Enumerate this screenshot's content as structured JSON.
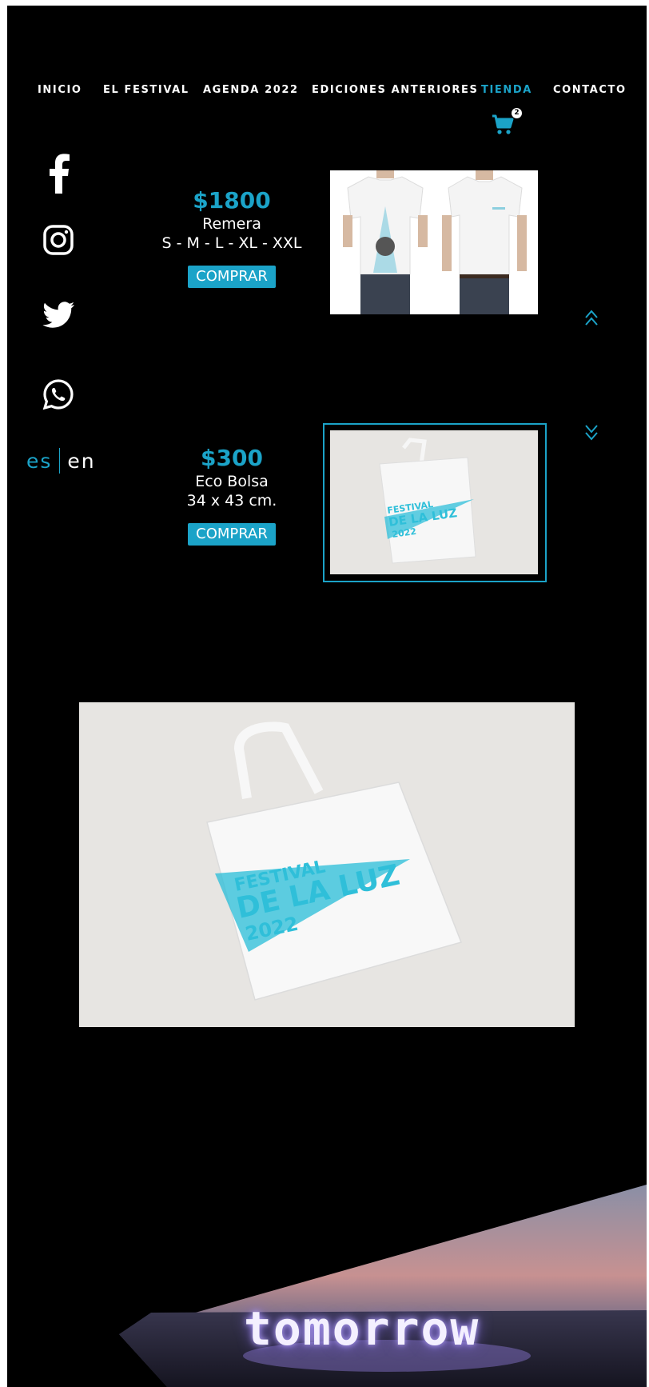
{
  "nav": {
    "items": [
      {
        "label": "INICIO",
        "active": false
      },
      {
        "label": "EL FESTIVAL",
        "active": false
      },
      {
        "label": "AGENDA 2022",
        "active": false
      },
      {
        "label": "EDICIONES ANTERIORES",
        "active": false
      },
      {
        "label": "TIENDA",
        "active": true
      },
      {
        "label": "CONTACTO",
        "active": false
      }
    ],
    "cart_count": "2"
  },
  "social": [
    "facebook-icon",
    "instagram-icon",
    "twitter-icon",
    "whatsapp-icon"
  ],
  "language": {
    "es": "es",
    "en": "en",
    "active": "es"
  },
  "products": [
    {
      "price": "$1800",
      "name": "Remera",
      "detail": "S - M - L - XL - XXL",
      "button": "COMPRAR"
    },
    {
      "price": "$300",
      "name": "Eco Bolsa",
      "detail": "34 x 43 cm.",
      "button": "COMPRAR"
    }
  ],
  "bag_print": {
    "line1": "FESTIVAL",
    "line2": "DE LA LUZ",
    "line3": "2022"
  },
  "banner": {
    "neon_text": "tomorrow"
  },
  "colors": {
    "accent": "#1ba3c8",
    "background": "#000000"
  }
}
